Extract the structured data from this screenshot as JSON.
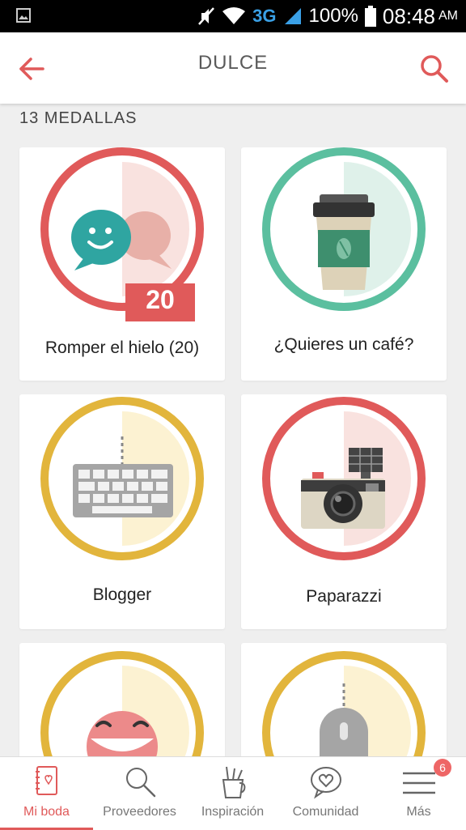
{
  "status_bar": {
    "battery": "100%",
    "network": "3G",
    "time": "08:48",
    "ampm": "AM"
  },
  "header": {
    "title": "DULCE"
  },
  "section": {
    "count_label": "13 MEDALLAS"
  },
  "medals": [
    {
      "name": "Romper el hielo (20)",
      "icon": "chat-bubbles-icon",
      "badge": "20",
      "color": "#e05a5a"
    },
    {
      "name": "¿Quieres un café?",
      "icon": "coffee-cup-icon",
      "color": "#5bbf9f"
    },
    {
      "name": "Blogger",
      "icon": "keyboard-icon",
      "color": "#e2b53c"
    },
    {
      "name": "Paparazzi",
      "icon": "camera-icon",
      "color": "#e05a5a"
    },
    {
      "name": "",
      "icon": "smiley-face-icon",
      "color": "#e2b53c"
    },
    {
      "name": "",
      "icon": "mouse-icon",
      "color": "#e2b53c"
    }
  ],
  "bottom_nav": {
    "items": [
      {
        "label": "Mi boda",
        "icon": "notebook-icon",
        "active": true
      },
      {
        "label": "Proveedores",
        "icon": "search-icon"
      },
      {
        "label": "Inspiración",
        "icon": "pencil-cup-icon"
      },
      {
        "label": "Comunidad",
        "icon": "heart-chat-icon"
      },
      {
        "label": "Más",
        "icon": "menu-icon",
        "badge": "6"
      }
    ]
  }
}
